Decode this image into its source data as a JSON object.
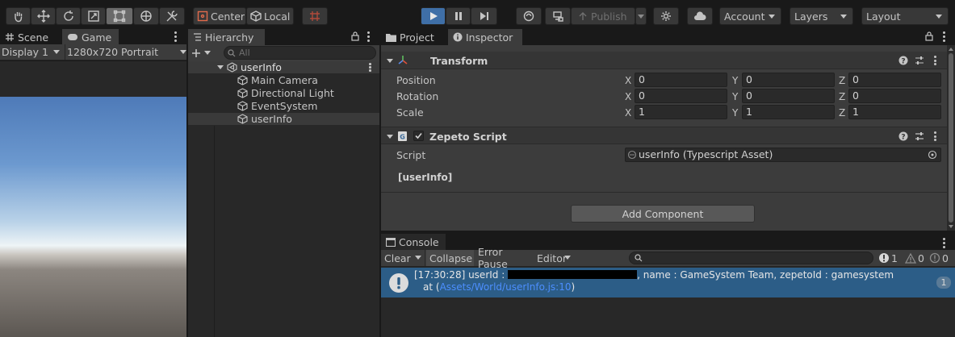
{
  "toolbar": {
    "pivot_label": "Center",
    "space_label": "Local",
    "publish_label": "Publish",
    "account_label": "Account",
    "layers_label": "Layers",
    "layout_label": "Layout"
  },
  "game": {
    "tabs": [
      "Scene",
      "Game"
    ],
    "display_label": "Display 1",
    "resolution_label": "1280x720 Portrait"
  },
  "hierarchy": {
    "tab_label": "Hierarchy",
    "search_placeholder": "All",
    "scene_name": "userInfo",
    "items": [
      "Main Camera",
      "Directional Light",
      "EventSystem",
      "userInfo"
    ]
  },
  "inspector": {
    "tabs": [
      "Project",
      "Inspector"
    ],
    "transform": {
      "title": "Transform",
      "rows": [
        {
          "label": "Position",
          "x": "0",
          "y": "0",
          "z": "0"
        },
        {
          "label": "Rotation",
          "x": "0",
          "y": "0",
          "z": "0"
        },
        {
          "label": "Scale",
          "x": "1",
          "y": "1",
          "z": "1"
        }
      ]
    },
    "script_component": {
      "title": "Zepeto Script",
      "script_label": "Script",
      "script_value": "userInfo (Typescript Asset)",
      "class_label": "[userInfo]"
    },
    "add_component_label": "Add Component"
  },
  "console": {
    "tab_label": "Console",
    "clear_label": "Clear",
    "collapse_label": "Collapse",
    "error_pause_label": "Error Pause",
    "editor_label": "Editor",
    "info_count": "1",
    "warn_count": "0",
    "error_count": "0",
    "log": {
      "prefix": "[17:30:28] userId : ",
      "suffix": ", name : GameSystem Team, zepetoId : gamesystem",
      "at_label": "at (",
      "link": "Assets/World/userInfo.js:10",
      "close": ")",
      "count": "1"
    }
  },
  "colors": {
    "accent": "#3f6fa7",
    "selected_row": "#2c5d87",
    "link": "#4c7efe"
  }
}
